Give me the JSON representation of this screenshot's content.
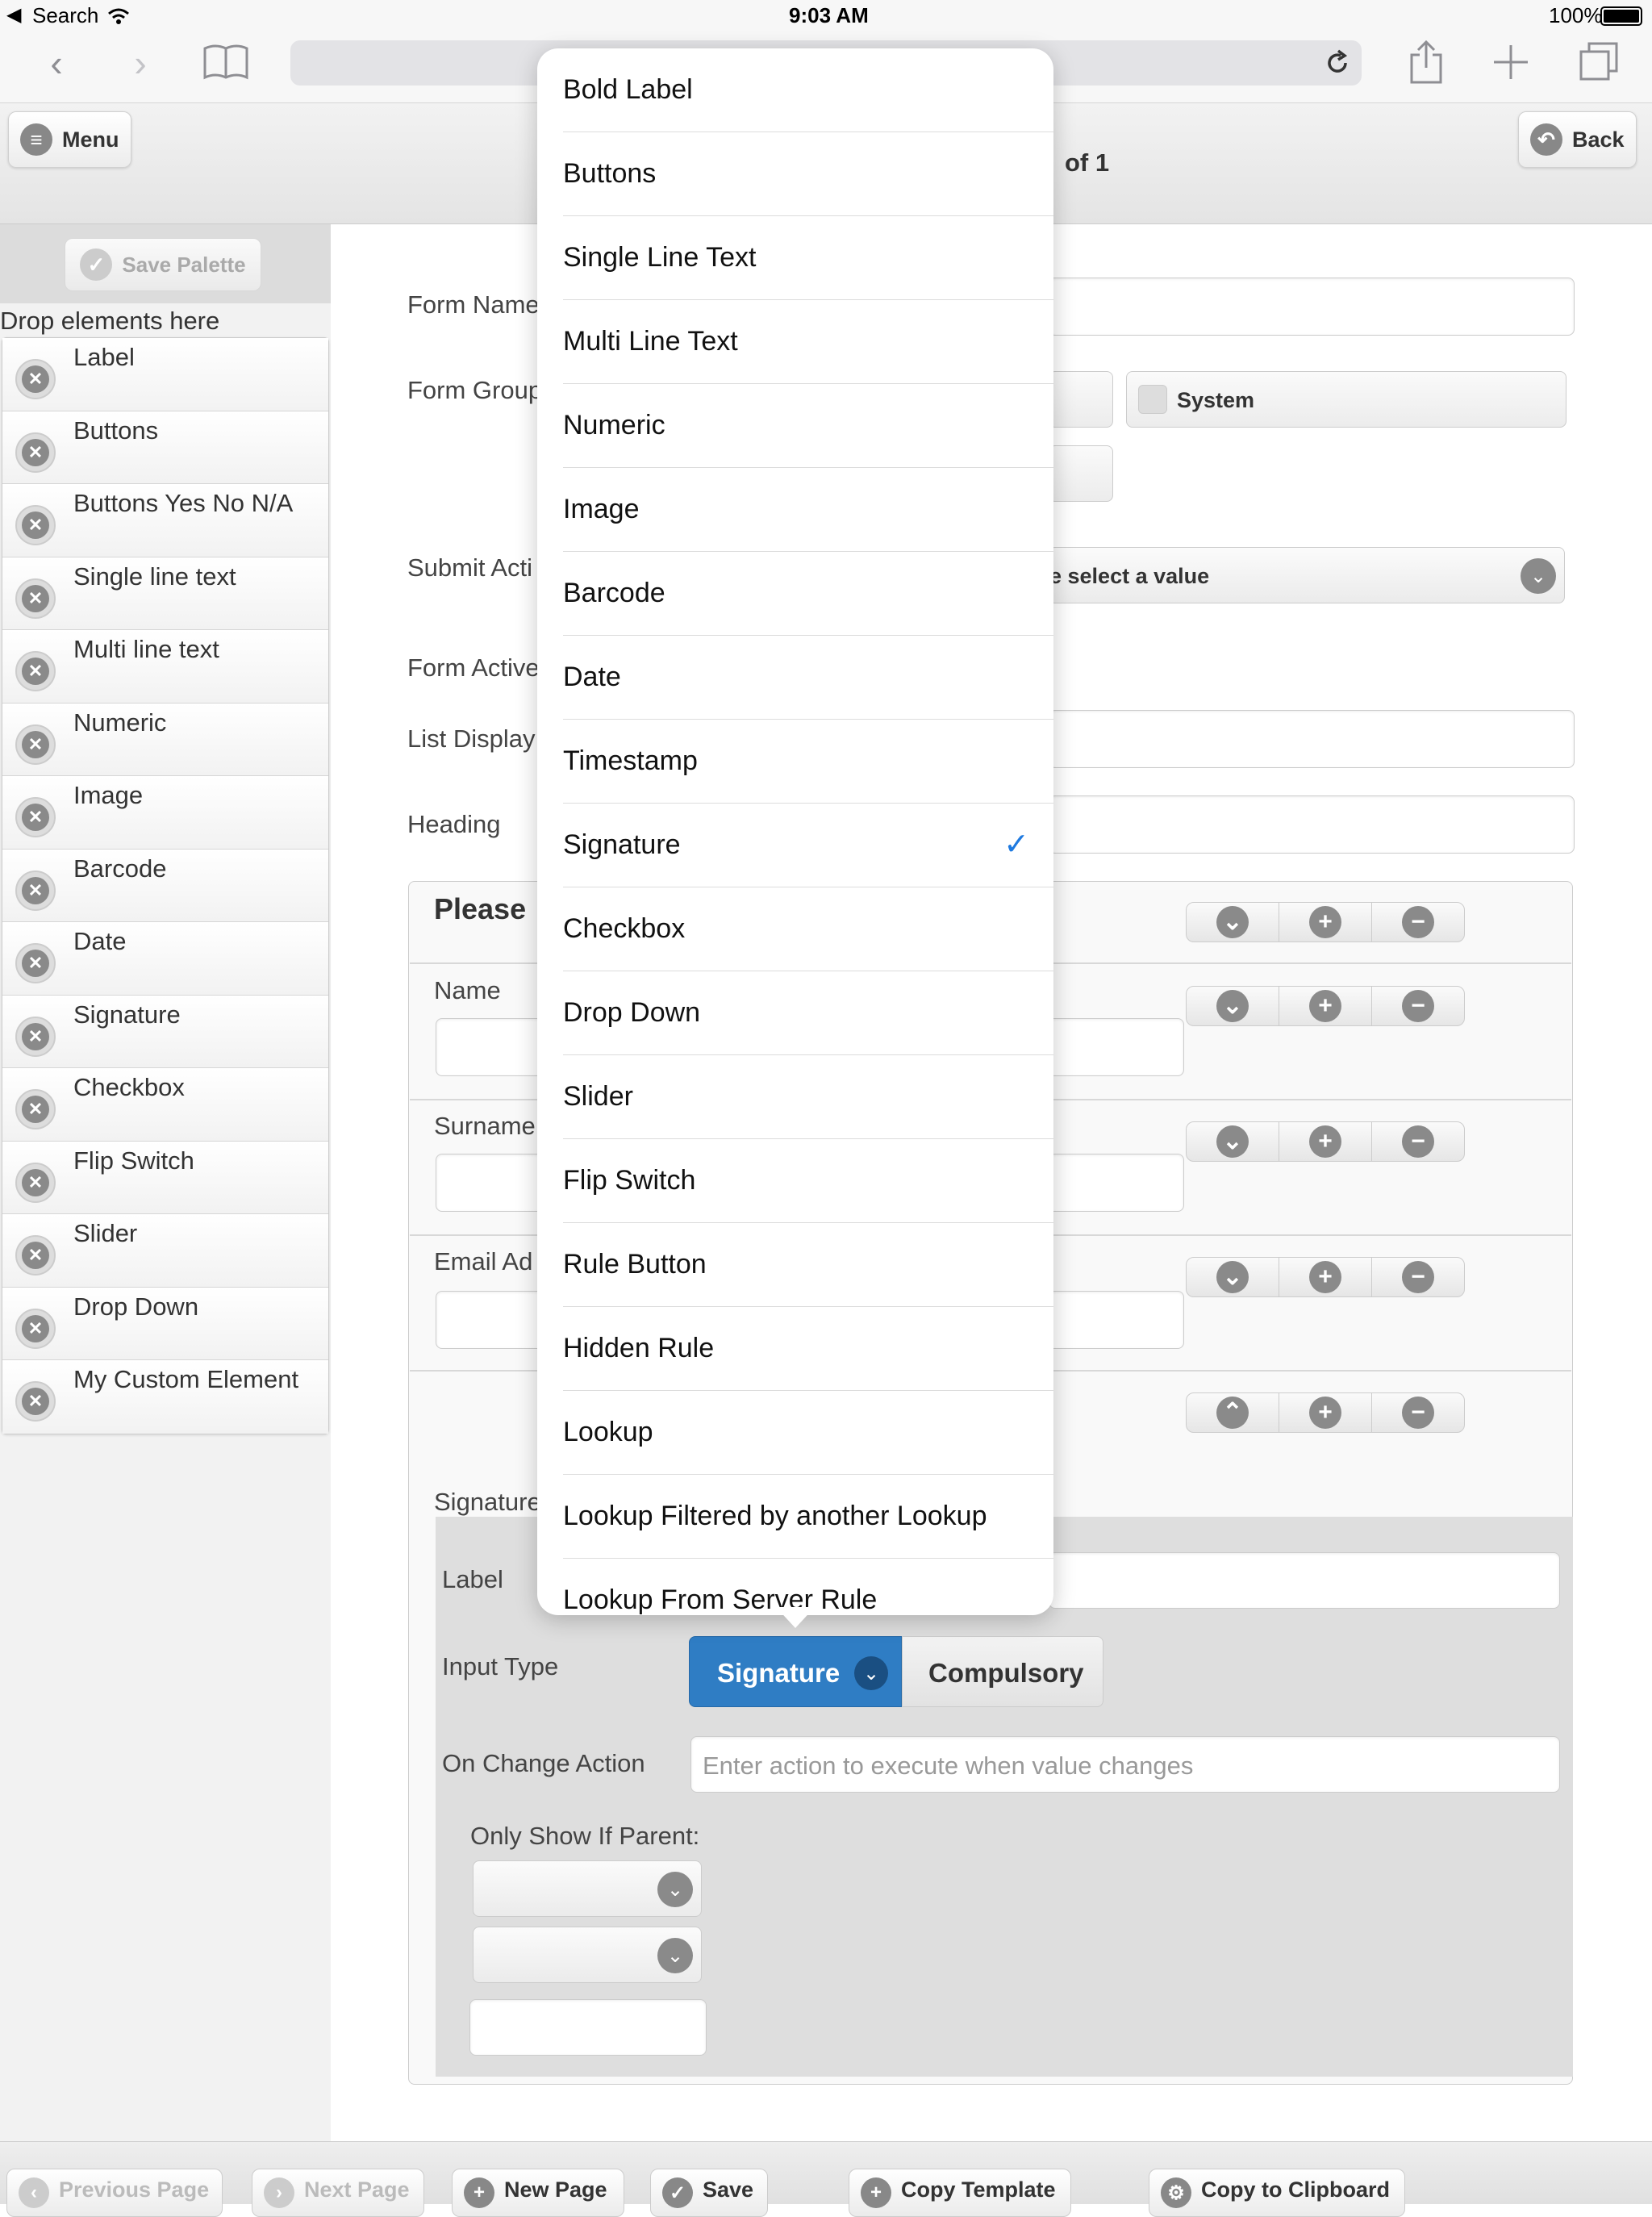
{
  "status_bar": {
    "back_app": "Search",
    "time": "9:03 AM",
    "battery": "100%"
  },
  "header": {
    "menu_label": "Menu",
    "page_indicator": "of 1",
    "back_label": "Back"
  },
  "palette": {
    "save_label": "Save Palette",
    "drop_title": "Drop elements here",
    "items": [
      "Label",
      "Buttons",
      "Buttons Yes No N/A",
      "Single line text",
      "Multi line text",
      "Numeric",
      "Image",
      "Barcode",
      "Date",
      "Signature",
      "Checkbox",
      "Flip Switch",
      "Slider",
      "Drop Down",
      "My Custom Element"
    ]
  },
  "form": {
    "form_name_label": "Form Name",
    "form_group_label": "Form Group",
    "system_label": "System",
    "submit_action_label": "Submit Acti",
    "submit_select_value": "e select a value",
    "form_active_label": "Form Active",
    "list_display_label": "List Display",
    "heading_label": "Heading",
    "section_title": "Please",
    "name_label": "Name",
    "surname_label": "Surname",
    "email_label": "Email Ad",
    "signature_label": "Signature"
  },
  "signature_editor": {
    "label_label": "Label",
    "input_type_label": "Input Type",
    "input_type_value": "Signature",
    "compulsory_label": "Compulsory",
    "on_change_label": "On Change Action",
    "on_change_placeholder": "Enter action to execute when value changes",
    "only_show_label": "Only Show If Parent:"
  },
  "popover": {
    "selected": "Signature",
    "options": [
      "Bold Label",
      "Buttons",
      "Single Line Text",
      "Multi Line Text",
      "Numeric",
      "Image",
      "Barcode",
      "Date",
      "Timestamp",
      "Signature",
      "Checkbox",
      "Drop Down",
      "Slider",
      "Flip Switch",
      "Rule Button",
      "Hidden Rule",
      "Lookup",
      "Lookup Filtered by another Lookup",
      "Lookup From Server Rule"
    ]
  },
  "bottom_bar": {
    "previous": "Previous Page",
    "next": "Next Page",
    "new_page": "New Page",
    "save": "Save",
    "copy_template": "Copy Template",
    "copy_clipboard": "Copy to Clipboard"
  },
  "colors": {
    "accent": "#2f7dc4",
    "check": "#1f7ae0",
    "panel": "#dedede"
  }
}
